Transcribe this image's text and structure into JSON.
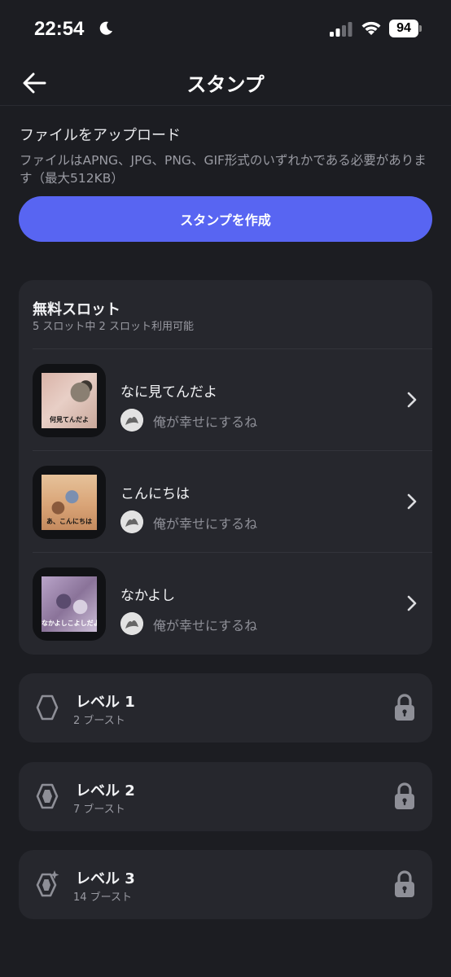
{
  "status_bar": {
    "time": "22:54",
    "battery": "94",
    "icons": [
      "moon-icon",
      "signal-icon",
      "wifi-icon",
      "battery-icon"
    ]
  },
  "nav": {
    "title": "スタンプ",
    "back_icon": "arrow-left-icon"
  },
  "upload": {
    "title": "ファイルをアップロード",
    "description": "ファイルはAPNG、JPG、PNG、GIF形式のいずれかである必要があります（最大512KB）",
    "button_label": "スタンプを作成",
    "accent": "#5865f2"
  },
  "free_slots": {
    "title": "無料スロット",
    "subtitle": "5 スロット中 2 スロット利用可能",
    "stickers": [
      {
        "name": "なに見てんだよ",
        "owner": "俺が幸せにするね",
        "caption": "何見てんだよ"
      },
      {
        "name": "こんにちは",
        "owner": "俺が幸せにするね",
        "caption": "あ、こんにちは"
      },
      {
        "name": "なかよし",
        "owner": "俺が幸せにするね",
        "caption": "なかよしこよしだよ。"
      }
    ]
  },
  "levels": [
    {
      "title": "レベル 1",
      "boosts": "2 ブースト",
      "icon": "gem-outline-icon",
      "locked": true
    },
    {
      "title": "レベル 2",
      "boosts": "7 ブースト",
      "icon": "gem-filled-icon",
      "locked": true
    },
    {
      "title": "レベル 3",
      "boosts": "14 ブースト",
      "icon": "gem-sparkle-icon",
      "locked": true
    }
  ]
}
